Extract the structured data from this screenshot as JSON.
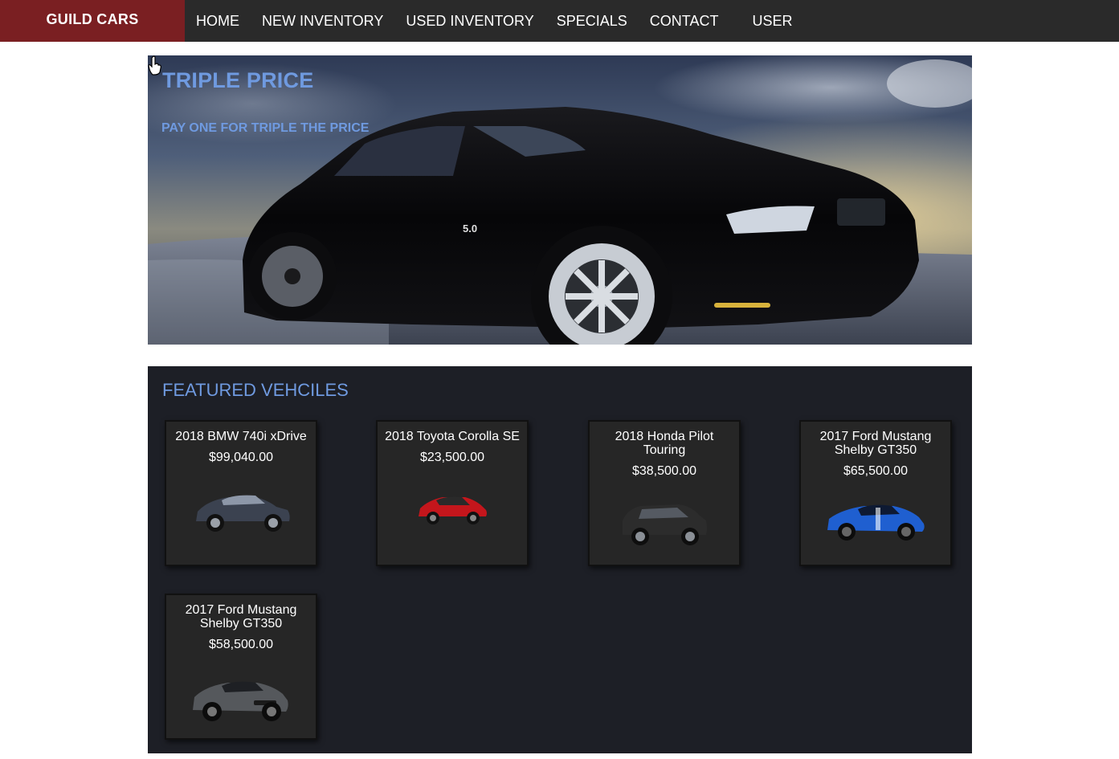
{
  "nav": {
    "brand": "GUILD CARS",
    "links": [
      "HOME",
      "NEW INVENTORY",
      "USED INVENTORY",
      "SPECIALS",
      "CONTACT",
      "USER"
    ]
  },
  "hero": {
    "title": "TRIPLE PRICE",
    "subtitle": "PAY ONE FOR TRIPLE THE PRICE"
  },
  "featured": {
    "title": "FEATURED VEHCILES",
    "vehicles": [
      {
        "name": "2018 BMW 740i xDrive",
        "price": "$99,040.00",
        "color": "#3b4250"
      },
      {
        "name": "2018 Toyota Corolla SE",
        "price": "$23,500.00",
        "color": "#c4161c"
      },
      {
        "name": "2018 Honda Pilot Touring",
        "price": "$38,500.00",
        "color": "#2c2c2c"
      },
      {
        "name": "2017 Ford Mustang Shelby GT350",
        "price": "$65,500.00",
        "color": "#1f5fd0"
      },
      {
        "name": "2017 Ford Mustang Shelby GT350",
        "price": "$58,500.00",
        "color": "#55585c"
      }
    ]
  },
  "colors": {
    "nav_bg": "#2a2a2a",
    "brand_bg": "#7a1f22",
    "accent": "#6f9ae0",
    "featured_bg": "#1d1f26",
    "card_bg": "#262626"
  }
}
